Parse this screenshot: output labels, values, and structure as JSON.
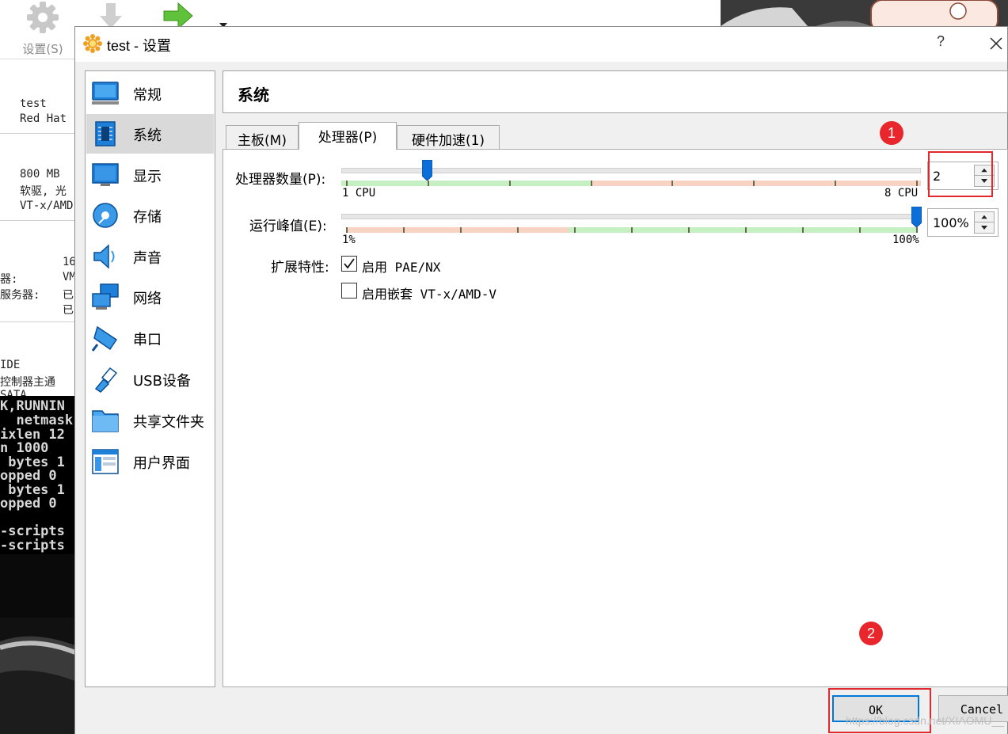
{
  "background": {
    "toolbar": {
      "settings_label": "设置(S)"
    },
    "details": {
      "name": "test",
      "os": "Red Hat",
      "memory": "800 MB",
      "boot": "软驱, 光",
      "accel": "VT-x/AMD",
      "video": "16",
      "ctrl_label": "器:",
      "ctrl_value": "VM",
      "server_label": "服务器:",
      "server_value1": "已",
      "server_value2": "已",
      "ide": "IDE",
      "controller": "控制器主通",
      "sata": "SATA"
    },
    "console_lines": [
      "K,RUNNIN",
      "  netmask",
      "ixlen 12",
      "n 1000",
      " bytes 1",
      "opped 0",
      " bytes 1",
      "opped 0 ",
      "",
      "-scripts",
      "-scripts"
    ]
  },
  "dialog": {
    "title": "test - 设置",
    "help": "?",
    "sidebar": [
      {
        "label": "常规",
        "icon": "general-icon"
      },
      {
        "label": "系统",
        "icon": "system-icon",
        "selected": true
      },
      {
        "label": "显示",
        "icon": "display-icon"
      },
      {
        "label": "存储",
        "icon": "storage-icon"
      },
      {
        "label": "声音",
        "icon": "audio-icon"
      },
      {
        "label": "网络",
        "icon": "network-icon"
      },
      {
        "label": "串口",
        "icon": "serial-port-icon"
      },
      {
        "label": "USB设备",
        "icon": "usb-icon"
      },
      {
        "label": "共享文件夹",
        "icon": "shared-folder-icon"
      },
      {
        "label": "用户界面",
        "icon": "user-interface-icon"
      }
    ],
    "section_title": "系统",
    "tabs": [
      "主板(M)",
      "处理器(P)",
      "硬件加速(1)"
    ],
    "active_tab": 1,
    "processor": {
      "cpu_count_label": "处理器数量(P):",
      "cpu_count_value": "2",
      "cpu_min_label": "1 CPU",
      "cpu_max_label": "8 CPU",
      "cpu_min": 1,
      "cpu_max": 8,
      "cpu_count": 2,
      "cap_label": "运行峰值(E):",
      "cap_value": "100%",
      "cap_min_label": "1%",
      "cap_max_label": "100%",
      "cap_percent": 100,
      "ext_label": "扩展特性:",
      "pae_label": "启用 PAE/NX",
      "pae_checked": true,
      "nested_label": "启用嵌套 VT-x/AMD-V",
      "nested_checked": false
    },
    "buttons": {
      "ok": "OK",
      "cancel": "Cancel"
    },
    "annotations": {
      "badge1": "1",
      "badge2": "2"
    },
    "watermark": "https://blog.csdn.net/XIAOMU__"
  },
  "colors": {
    "accent": "#0078d7",
    "badge": "#e8262b",
    "slider_green": "#c4f0c4",
    "slider_red": "#f8d2c2"
  }
}
